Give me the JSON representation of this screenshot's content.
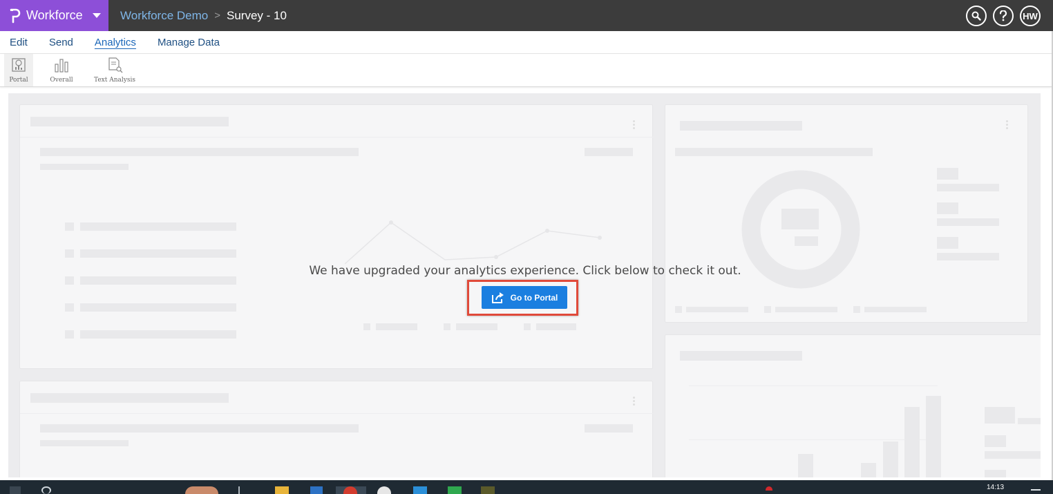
{
  "header": {
    "brand": "Workforce",
    "breadcrumb": {
      "org": "Workforce Demo",
      "separator": ">",
      "current": "Survey - 10"
    },
    "icons": [
      "search-icon",
      "help-icon"
    ],
    "user_initials": "HW"
  },
  "tabs": [
    {
      "label": "Edit",
      "active": false
    },
    {
      "label": "Send",
      "active": false
    },
    {
      "label": "Analytics",
      "active": true
    },
    {
      "label": "Manage Data",
      "active": false
    }
  ],
  "subtoolbar": [
    {
      "label": "Portal",
      "icon": "portal-icon",
      "selected": true
    },
    {
      "label": "Overall",
      "icon": "bar-chart-icon",
      "selected": false
    },
    {
      "label": "Text Analysis",
      "icon": "text-analysis-icon",
      "selected": false
    }
  ],
  "overlay": {
    "message": "We have upgraded your analytics experience. Click below to check it out.",
    "button_label": "Go to Portal",
    "button_icon": "share-icon"
  },
  "taskbar": {
    "time": "14:13"
  },
  "colors": {
    "brand": "#8d4fd8",
    "topbar": "#3c3c3c",
    "accent": "#1b7fe0",
    "highlight": "#e04a3a"
  }
}
